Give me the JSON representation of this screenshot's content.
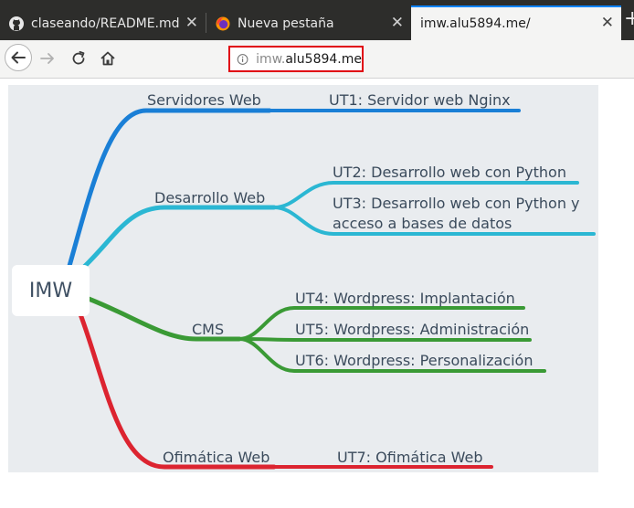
{
  "tabs": [
    {
      "title": "claseando/README.md",
      "icon": "github-icon",
      "active": false
    },
    {
      "title": "Nueva pestaña",
      "icon": "firefox-icon",
      "active": false
    },
    {
      "title": "imw.alu5894.me/",
      "icon": "",
      "active": true
    }
  ],
  "navbar": {
    "url_prefix": "imw.",
    "url_domain": "alu5894.me"
  },
  "mindmap": {
    "root": "IMW",
    "branches": [
      {
        "label": "Servidores Web",
        "color": "#1a7fd6",
        "children": [
          "UT1: Servidor web Nginx"
        ]
      },
      {
        "label": "Desarrollo Web",
        "color": "#2bb7d3",
        "children": [
          "UT2: Desarrollo web con Python",
          "UT3: Desarrollo web con Python y acceso a bases de datos"
        ]
      },
      {
        "label": "CMS",
        "color": "#3a9a35",
        "children": [
          "UT4: Wordpress: Implantación",
          "UT5: Wordpress: Administración",
          "UT6: Wordpress: Personalización"
        ]
      },
      {
        "label": "Ofimática Web",
        "color": "#dc2430",
        "children": [
          "UT7: Ofimática Web"
        ]
      }
    ],
    "ut3_line1": "UT3: Desarrollo web con Python y",
    "ut3_line2": "acceso a bases de datos"
  }
}
